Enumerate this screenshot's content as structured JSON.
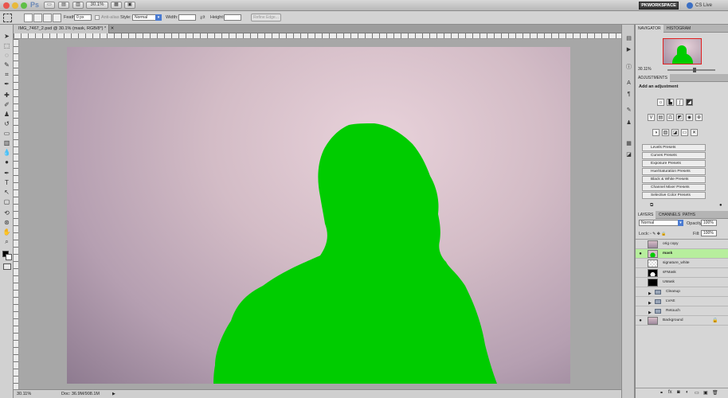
{
  "app": {
    "logo": "Ps",
    "zoom_menu": "30.1%",
    "workspace": "PKWORKSPACE",
    "cs_live": "CS Live"
  },
  "options": {
    "feather_label": "Feather:",
    "feather_value": "0 px",
    "antialias_label": "Anti-alias",
    "style_label": "Style:",
    "style_value": "Normal",
    "width_label": "Width:",
    "height_label": "Height:",
    "refine_button": "Refine Edge..."
  },
  "document": {
    "tab_title": "IMG_7467_2.psd @ 30.1% (mask, RGB/8*) *"
  },
  "status": {
    "zoom": "30.11%",
    "doc_size": "Doc: 36.9M/908.1M"
  },
  "navigator": {
    "tabs": [
      "NAVIGATOR",
      "HISTOGRAM"
    ],
    "zoom": "30.11%"
  },
  "adjustments": {
    "tab": "ADJUSTMENTS",
    "heading": "Add an adjustment",
    "presets": [
      "Levels Presets",
      "Curves Presets",
      "Exposure Presets",
      "Hue/Saturation Presets",
      "Black & White Presets",
      "Channel Mixer Presets",
      "Selective Color Presets"
    ]
  },
  "layers_panel": {
    "tabs": [
      "LAYERS",
      "CHANNELS",
      "PATHS"
    ],
    "blend_mode": "Normal",
    "opacity_label": "Opacity:",
    "opacity_value": "100%",
    "lock_label": "Lock:",
    "fill_label": "Fill:",
    "fill_value": "100%",
    "layers": [
      "orig copy",
      "mask",
      "signature_white",
      "sFMask",
      "UMask",
      "Cleanup",
      "LVAE",
      "Retouch",
      "Background"
    ]
  },
  "colors": {
    "mask_green": "#00cc00",
    "selected_layer": "#b7ee9d"
  }
}
